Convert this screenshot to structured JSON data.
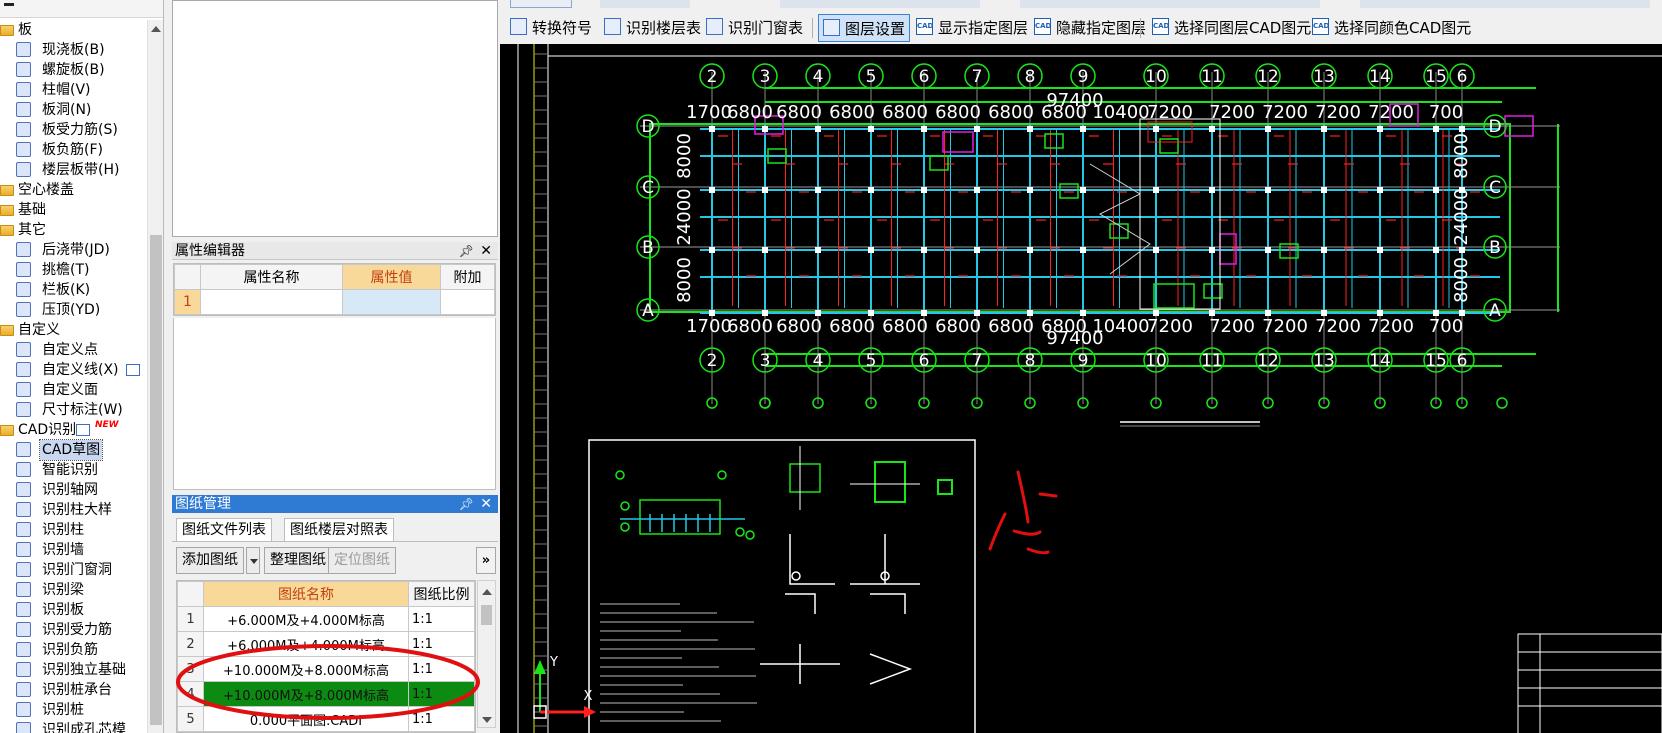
{
  "tree": {
    "items": [
      {
        "label": "板",
        "level": 0,
        "icon": "folder-icon"
      },
      {
        "label": "现浇板(B)",
        "level": 1,
        "icon": "slab-icon"
      },
      {
        "label": "螺旋板(B)",
        "level": 1,
        "icon": "spiral-slab-icon"
      },
      {
        "label": "柱帽(V)",
        "level": 1,
        "icon": "column-cap-icon"
      },
      {
        "label": "板洞(N)",
        "level": 1,
        "icon": "slab-hole-icon"
      },
      {
        "label": "板受力筋(S)",
        "level": 1,
        "icon": "slab-rebar-icon"
      },
      {
        "label": "板负筋(F)",
        "level": 1,
        "icon": "negative-rebar-icon"
      },
      {
        "label": "楼层板带(H)",
        "level": 1,
        "icon": "floor-strip-icon"
      },
      {
        "label": "空心楼盖",
        "level": 0,
        "icon": "folder-icon"
      },
      {
        "label": "基础",
        "level": 0,
        "icon": "folder-icon"
      },
      {
        "label": "其它",
        "level": 0,
        "icon": "folder-icon"
      },
      {
        "label": "后浇带(JD)",
        "level": 1,
        "icon": "post-pour-strip-icon"
      },
      {
        "label": "挑檐(T)",
        "level": 1,
        "icon": "eave-icon"
      },
      {
        "label": "栏板(K)",
        "level": 1,
        "icon": "parapet-icon"
      },
      {
        "label": "压顶(YD)",
        "level": 1,
        "icon": "coping-icon"
      },
      {
        "label": "自定义",
        "level": 0,
        "icon": "folder-icon"
      },
      {
        "label": "自定义点",
        "level": 1,
        "icon": "custom-point-icon"
      },
      {
        "label": "自定义线(X)",
        "level": 1,
        "icon": "custom-line-icon",
        "extra": "box"
      },
      {
        "label": "自定义面",
        "level": 1,
        "icon": "custom-face-icon"
      },
      {
        "label": "尺寸标注(W)",
        "level": 1,
        "icon": "dimension-icon"
      },
      {
        "label": "CAD识别",
        "level": 0,
        "icon": "folder-icon",
        "extra": "new",
        "badge": "NEW"
      },
      {
        "label": "CAD草图",
        "level": 1,
        "icon": "cad-sketch-icon",
        "selected": true
      },
      {
        "label": "智能识别",
        "level": 1,
        "icon": "smart-recognize-icon"
      },
      {
        "label": "识别轴网",
        "level": 1,
        "icon": "recognize-axis-icon"
      },
      {
        "label": "识别柱大样",
        "level": 1,
        "icon": "recognize-column-detail-icon"
      },
      {
        "label": "识别柱",
        "level": 1,
        "icon": "recognize-column-icon"
      },
      {
        "label": "识别墙",
        "level": 1,
        "icon": "recognize-wall-icon"
      },
      {
        "label": "识别门窗洞",
        "level": 1,
        "icon": "recognize-door-window-icon"
      },
      {
        "label": "识别梁",
        "level": 1,
        "icon": "recognize-beam-icon"
      },
      {
        "label": "识别板",
        "level": 1,
        "icon": "recognize-slab-icon"
      },
      {
        "label": "识别受力筋",
        "level": 1,
        "icon": "recognize-rebar-icon"
      },
      {
        "label": "识别负筋",
        "level": 1,
        "icon": "recognize-negative-rebar-icon"
      },
      {
        "label": "识别独立基础",
        "level": 1,
        "icon": "recognize-footing-icon"
      },
      {
        "label": "识别桩承台",
        "level": 1,
        "icon": "recognize-pile-cap-icon"
      },
      {
        "label": "识别桩",
        "level": 1,
        "icon": "recognize-pile-icon"
      },
      {
        "label": "识别成孔芯模",
        "level": 1,
        "icon": "recognize-core-mold-icon"
      }
    ]
  },
  "property_editor": {
    "title": "属性编辑器",
    "col_name": "属性名称",
    "col_value": "属性值",
    "col_extra": "附加",
    "row_number": "1"
  },
  "drawing_manager": {
    "title": "图纸管理",
    "tabs": [
      "图纸文件列表",
      "图纸楼层对照表"
    ],
    "buttons": {
      "add": "添加图纸",
      "organize": "整理图纸",
      "locate": "定位图纸",
      "more": "»"
    },
    "col_name": "图纸名称",
    "col_scale": "图纸比例",
    "rows": [
      {
        "num": "1",
        "name": "+6.000M及+4.000M标高",
        "scale": "1:1"
      },
      {
        "num": "2",
        "name": "+6.000M及+4.000M标高",
        "scale": "1:1"
      },
      {
        "num": "3",
        "name": "+10.000M及+8.000M标高",
        "scale": "1:1"
      },
      {
        "num": "4",
        "name": "+10.000M及+8.000M标高",
        "scale": "1:1",
        "highlighted": true
      },
      {
        "num": "5",
        "name": "0.000平面图.CADI",
        "scale": "1:1"
      }
    ]
  },
  "toolbar": {
    "items": [
      {
        "label": "转换符号",
        "icon": "convert-symbol-icon"
      },
      {
        "label": "识别楼层表",
        "icon": "recognize-floor-table-icon"
      },
      {
        "label": "识别门窗表",
        "icon": "recognize-door-window-table-icon"
      },
      {
        "label": "图层设置",
        "icon": "layer-settings-icon",
        "active": true
      },
      {
        "label": "显示指定图层",
        "icon": "show-layer-icon"
      },
      {
        "label": "隐藏指定图层",
        "icon": "hide-layer-icon"
      },
      {
        "label": "选择同图层CAD图元",
        "icon": "select-same-layer-icon"
      },
      {
        "label": "选择同颜色CAD图元",
        "icon": "select-same-color-icon"
      }
    ]
  },
  "cad_drawing": {
    "axis_numbers_top": [
      "2",
      "3",
      "4",
      "5",
      "6",
      "7",
      "8",
      "9",
      "10",
      "11",
      "12",
      "13",
      "14",
      "15",
      "6"
    ],
    "axis_numbers_bottom": [
      "2",
      "3",
      "4",
      "5",
      "6",
      "7",
      "8",
      "9",
      "10",
      "11",
      "12",
      "13",
      "14",
      "15",
      "6"
    ],
    "dims_top": [
      "1700",
      "6800",
      "6800",
      "6800",
      "6800",
      "6800",
      "6800",
      "6800",
      "10400",
      "7200",
      "7200",
      "7200",
      "7200",
      "7200",
      "700"
    ],
    "dims_bottom": [
      "1700",
      "6800",
      "6800",
      "6800",
      "6800",
      "6800",
      "6800",
      "6800",
      "10400",
      "7200",
      "7200",
      "7200",
      "7200",
      "7200",
      "700"
    ],
    "total_top": "97400",
    "total_bottom": "97400",
    "row_letters": [
      "D",
      "C",
      "B",
      "A"
    ],
    "row_letters_right": [
      "D",
      "C",
      "B",
      "A"
    ],
    "side_dims_left": [
      "8000",
      "24000",
      "8000"
    ],
    "side_dims_right": [
      "8000",
      "24000",
      "8000"
    ],
    "coord_y": "Y",
    "coord_x": "X",
    "colors": {
      "green": "#19e619",
      "cyan": "#22c8e6",
      "red": "#ff2020",
      "white": "#ffffff",
      "magenta": "#e01fe0",
      "yellow": "#e6e61a"
    }
  }
}
